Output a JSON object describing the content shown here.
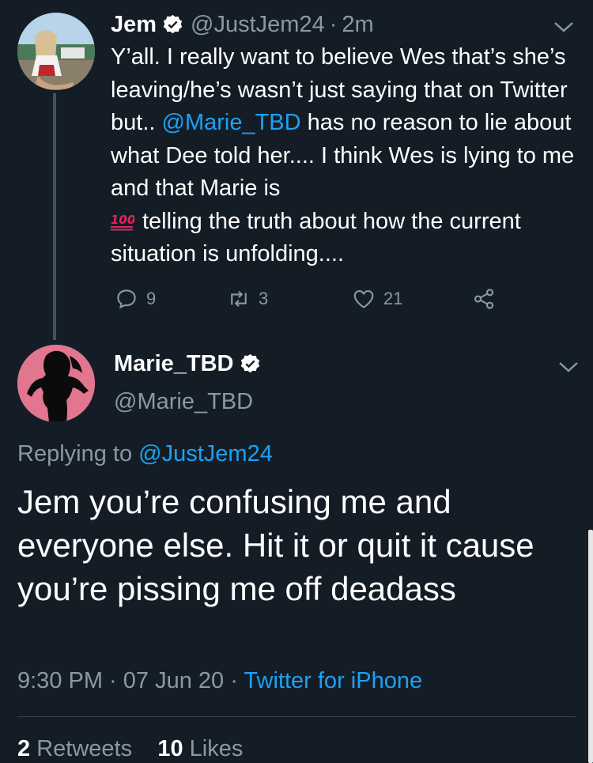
{
  "parent_tweet": {
    "display_name": "Jem",
    "handle": "@JustJem24",
    "separator": "·",
    "time": "2m",
    "text_1": "Y’all. I really want to believe Wes that’s she’s leaving/he’s wasn’t just saying that on Twitter but..  ",
    "mention": "@Marie_TBD",
    "text_2": " has no reason to lie about what Dee told her.... I think Wes is lying to me and that Marie is ",
    "text_3": "telling the truth about how the current situation is unfolding....",
    "emoji_icon": "hundred-points-emoji",
    "actions": {
      "reply_count": "9",
      "retweet_count": "3",
      "like_count": "21"
    }
  },
  "main_tweet": {
    "display_name": "Marie_TBD",
    "handle": "@Marie_TBD",
    "replying_prefix": "Replying to ",
    "replying_to": "@JustJem24",
    "text": "Jem you’re confusing me and everyone else. Hit it or quit it cause you’re pissing me off deadass",
    "time": "9:30 PM",
    "dot": " · ",
    "date": "07 Jun 20",
    "client": "Twitter for iPhone",
    "retweets_count": "2",
    "retweets_label": "Retweets",
    "likes_count": "10",
    "likes_label": "Likes"
  },
  "colors": {
    "background": "#141d26",
    "link": "#1da1f2",
    "secondary_text": "#8899a6",
    "avatar_pink": "#e2768f"
  }
}
